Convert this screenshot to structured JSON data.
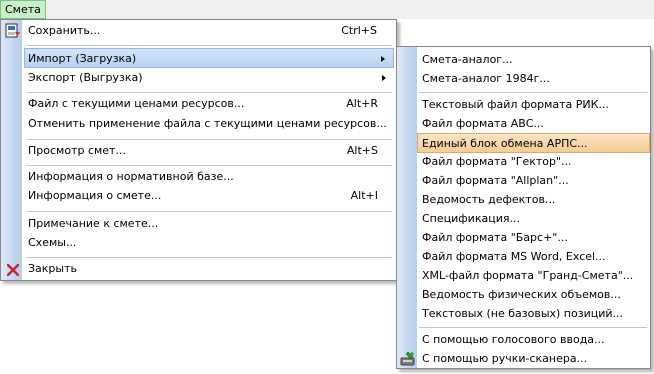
{
  "menubar": {
    "title": "Смета"
  },
  "main_menu": {
    "items": [
      {
        "label": "Сохранить...",
        "shortcut": "Ctrl+S"
      },
      {
        "label": "Импорт (Загрузка)"
      },
      {
        "label": "Экспорт (Выгрузка)"
      },
      {
        "label": "Файл с текущими ценами ресурсов...",
        "shortcut": "Alt+R"
      },
      {
        "label": "Отменить применение файла с текущими ценами ресурсов..."
      },
      {
        "label": "Просмотр смет...",
        "shortcut": "Alt+S"
      },
      {
        "label": "Информация о нормативной базе..."
      },
      {
        "label": "Информация о смете...",
        "shortcut": "Alt+I"
      },
      {
        "label": "Примечание к смете..."
      },
      {
        "label": "Схемы..."
      },
      {
        "label": "Закрыть"
      }
    ]
  },
  "import_submenu": {
    "items": [
      {
        "label": "Смета-аналог..."
      },
      {
        "label": "Смета-аналог 1984г..."
      },
      {
        "label": "Текстовый файл формата РИК..."
      },
      {
        "label": "Файл формата АВС..."
      },
      {
        "label": "Единый блок обмена АРПС..."
      },
      {
        "label": "Файл формата \"Гектор\"..."
      },
      {
        "label": "Файл формата \"Allplan\"..."
      },
      {
        "label": "Ведомость дефектов..."
      },
      {
        "label": "Спецификация..."
      },
      {
        "label": "Файл формата \"Барс+\"..."
      },
      {
        "label": "Файл формата MS Word, Excel..."
      },
      {
        "label": "XML-файл формата \"Гранд-Смета\"..."
      },
      {
        "label": "Ведомость физических объемов..."
      },
      {
        "label": "Текстовых (не базовых) позиций..."
      },
      {
        "label": "С помощью голосового ввода..."
      },
      {
        "label": "С помощью ручки-сканера..."
      }
    ]
  },
  "icons": {
    "save": "save-icon",
    "close": "close-x-icon",
    "scanner": "scanner-pen-icon"
  },
  "colors": {
    "highlight_blue": "#c9dcf4",
    "highlight_orange": "#f8d4a6",
    "menubar_active": "#c9f0c8",
    "close_red": "#c0262b"
  }
}
